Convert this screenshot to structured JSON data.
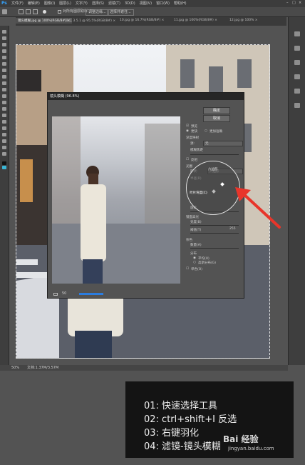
{
  "app": {
    "logo": "Ps"
  },
  "menubar": {
    "items": [
      "文件(F)",
      "编辑(E)",
      "图像(I)",
      "图层(L)",
      "文字(Y)",
      "选择(S)",
      "滤镜(T)",
      "3D(D)",
      "视图(V)",
      "窗口(W)",
      "帮助(H)"
    ]
  },
  "options_bar": {
    "feather_label": "调整边缘...",
    "sample_label": "对所有图层取样",
    "refine_label": "选择并遮住..."
  },
  "tabs": [
    {
      "label": "镜头模糊.jpg @ 100%(RGB/8#) ×",
      "active": true
    },
    {
      "label": "微信 3.5.1 @ 95.5%(RGB/8#) ×",
      "active": false
    },
    {
      "label": "10.jpg @ 16.7%(RGB/8#) ×",
      "active": false
    },
    {
      "label": "11.jpg @ 100%(RGB/8#) ×",
      "active": false
    },
    {
      "label": "12.jpg @ 100% ×",
      "active": false
    }
  ],
  "status_bar": {
    "zoom": "50%",
    "doc": "文档:1.37M/3.57M"
  },
  "dialog": {
    "title": "镜头模糊 (96.8%)",
    "ok": "确定",
    "cancel": "取消",
    "preview_label": "预览",
    "faster_label": "更快",
    "accurate_label": "更加准确",
    "depth_map_label": "深度映射",
    "source_label": "源:",
    "source_value": "无",
    "blur_focus_label": "模糊焦距",
    "invert_label": "反相",
    "iris_label": "光圈",
    "shape_label": "形状:",
    "shape_value": "六边形",
    "radius_label": "半径(R)",
    "blade_label": "叶片弯度(C)",
    "rotation_label": "旋转",
    "specular_label": "镜面高光",
    "brightness_label": "亮度(B)",
    "threshold_label": "阈值(T)",
    "threshold_value": "255",
    "noise_label": "杂色",
    "amount_label": "数量(A)",
    "distribution_label": "分布",
    "uniform_label": "平均(U)",
    "gaussian_label": "高斯分布(G)",
    "mono_label": "单色(O)",
    "zoom_value": "50"
  },
  "instructions": [
    "01:  快速选择工具",
    "02:  ctrl+shift+I 反选",
    "03:  右键羽化",
    "04:  滤镜-镜头模糊"
  ],
  "watermark": {
    "brand": "Bai 经验",
    "url": "jingyan.baidu.com"
  },
  "colors": {
    "arrow": "#e8352a",
    "ui_dark": "#3c3c3c",
    "canvas_bg": "#535353"
  }
}
